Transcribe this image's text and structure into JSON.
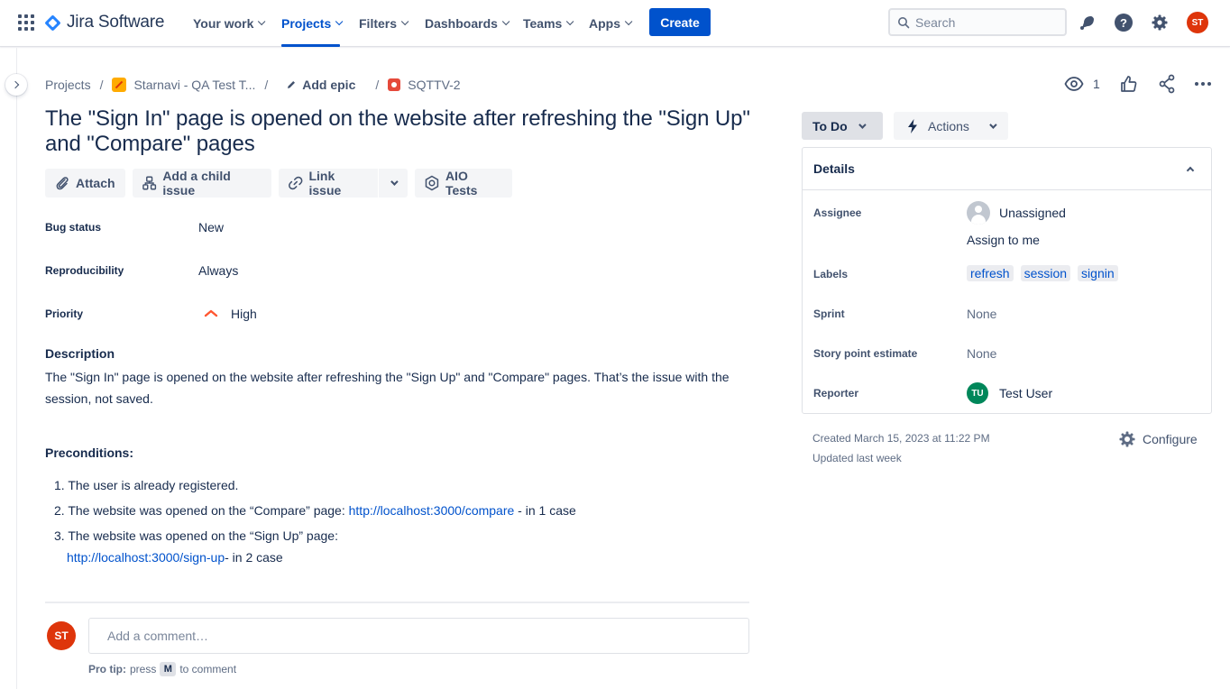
{
  "nav": {
    "product_name": "Jira Software",
    "items": [
      {
        "label": "Your work"
      },
      {
        "label": "Projects"
      },
      {
        "label": "Filters"
      },
      {
        "label": "Dashboards"
      },
      {
        "label": "Teams"
      },
      {
        "label": "Apps"
      }
    ],
    "create_label": "Create",
    "search_placeholder": "Search",
    "user_initials": "ST",
    "help_glyph": "?"
  },
  "breadcrumbs": {
    "root": "Projects",
    "project": "Starnavi - QA Test T...",
    "epic": "Add epic",
    "issue_key": "SQTTV-2"
  },
  "watchers_count": "1",
  "issue": {
    "title": "The \"Sign In\" page is opened on the website after refreshing the \"Sign Up\" and \"Compare\" pages",
    "buttons": {
      "attach": "Attach",
      "add_child": "Add a child issue",
      "link_issue": "Link issue",
      "aio_tests": "AIO Tests"
    },
    "fields": {
      "bug_status_label": "Bug status",
      "bug_status_value": "New",
      "reproducibility_label": "Reproducibility",
      "reproducibility_value": "Always",
      "priority_label": "Priority",
      "priority_value": "High"
    },
    "description_heading": "Description",
    "description_text": "The \"Sign In\" page is opened on the website after refreshing the \"Sign Up\" and \"Compare\" pages. That’s the issue with the session, not saved.",
    "preconditions_heading": "Preconditions:",
    "preconditions": {
      "item1_num": "1.",
      "item1": "The user is already registered.",
      "item2_num": "2.",
      "item2_text": "The website was opened on the “Compare” page: ",
      "item2_link": "http://localhost:3000/compare",
      "item2_suffix": " - in 1 case",
      "item3_num": "3.",
      "item3_text": "The website was opened on the “Sign Up” page:",
      "item3_link": "http://localhost:3000/sign-up",
      "item3_suffix": "- in 2 case"
    }
  },
  "comment": {
    "avatar_initials": "ST",
    "placeholder": "Add a comment…",
    "protip_bold": "Pro tip:",
    "protip_press": "press",
    "protip_key": "M",
    "protip_rest": "to comment"
  },
  "sidebar": {
    "status": "To Do",
    "actions": "Actions",
    "details_title": "Details",
    "assignee_label": "Assignee",
    "assignee_value": "Unassigned",
    "assign_to_me": "Assign to me",
    "labels_label": "Labels",
    "labels": [
      "refresh",
      "session",
      "signin"
    ],
    "sprint_label": "Sprint",
    "sprint_value": "None",
    "story_points_label": "Story point estimate",
    "story_points_value": "None",
    "reporter_label": "Reporter",
    "reporter_initials": "TU",
    "reporter_name": "Test User",
    "created": "Created March 15, 2023 at 11:22 PM",
    "updated": "Updated last week",
    "configure": "Configure"
  },
  "colors": {
    "brand_blue": "#0052cc",
    "priority_high": "#ff5630",
    "avatar_st": "#de350b",
    "avatar_tu": "#00875a"
  },
  "icons": [
    "app-switcher-icon",
    "jira-logo-icon",
    "search-icon",
    "notifications-icon",
    "help-icon",
    "settings-icon",
    "eye-icon",
    "thumbs-up-icon",
    "share-icon",
    "more-icon",
    "paperclip-icon",
    "child-issue-icon",
    "link-icon",
    "aio-tests-icon",
    "priority-high-icon",
    "lightning-icon",
    "gear-icon",
    "pencil-icon",
    "bug-icon"
  ]
}
